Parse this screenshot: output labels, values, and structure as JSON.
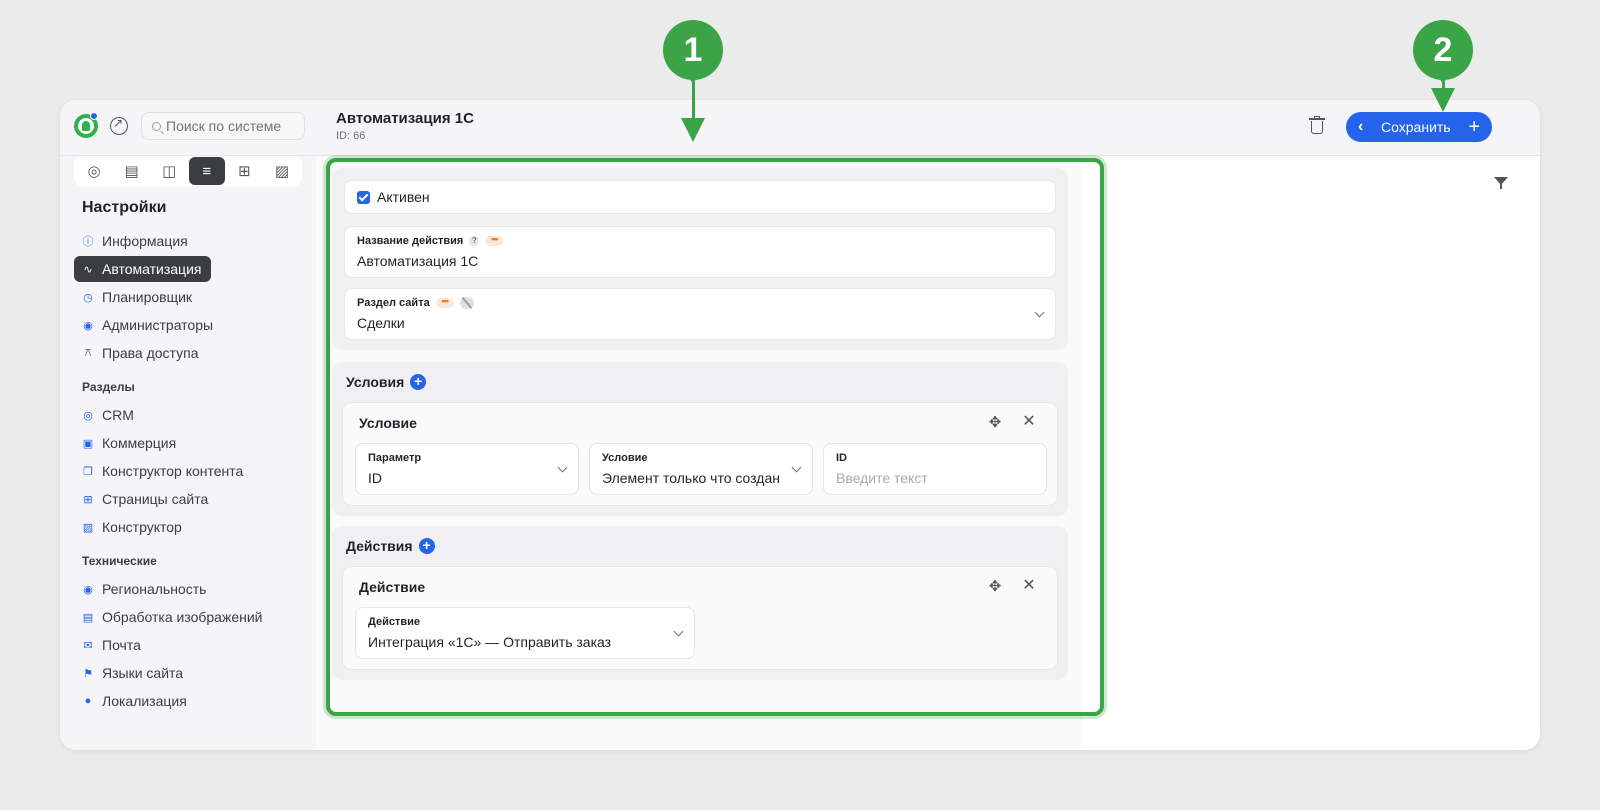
{
  "header": {
    "search_placeholder": "Поиск по системе",
    "title": "Автоматизация 1С",
    "id_label": "ID: 66",
    "save_label": "Сохранить"
  },
  "sidebar": {
    "heading": "Настройки",
    "strip_icons": [
      "crm-icon",
      "content-icon",
      "book-icon",
      "settings-sliders-icon",
      "add-square-icon",
      "constructor-icon"
    ],
    "settings_items": [
      {
        "label": "Информация",
        "icon": "info-icon"
      },
      {
        "label": "Автоматизация",
        "icon": "automation-icon",
        "active": true
      },
      {
        "label": "Планировщик",
        "icon": "scheduler-icon"
      },
      {
        "label": "Администраторы",
        "icon": "admin-icon"
      },
      {
        "label": "Права доступа",
        "icon": "lock-icon"
      }
    ],
    "sections_label": "Разделы",
    "sections_items": [
      {
        "label": "CRM",
        "icon": "crm-icon"
      },
      {
        "label": "Коммерция",
        "icon": "bag-icon"
      },
      {
        "label": "Конструктор контента",
        "icon": "copy-icon"
      },
      {
        "label": "Страницы сайта",
        "icon": "grid-icon"
      },
      {
        "label": "Конструктор",
        "icon": "constructor-icon"
      }
    ],
    "tech_label": "Технические",
    "tech_items": [
      {
        "label": "Региональность",
        "icon": "pin-icon"
      },
      {
        "label": "Обработка изображений",
        "icon": "image-icon"
      },
      {
        "label": "Почта",
        "icon": "mail-icon"
      },
      {
        "label": "Языки сайта",
        "icon": "flag-icon"
      },
      {
        "label": "Локализация",
        "icon": "globe-icon"
      }
    ]
  },
  "form": {
    "active_label": "Активен",
    "active_checked": true,
    "action_name_label": "Название действия",
    "action_name_value": "Автоматизация 1С",
    "site_section_label": "Раздел сайта",
    "site_section_value": "Сделки"
  },
  "conditions": {
    "title": "Условия",
    "card_title": "Условие",
    "param_label": "Параметр",
    "param_value": "ID",
    "condition_label": "Условие",
    "condition_value": "Элемент только что создан",
    "id_label": "ID",
    "id_placeholder": "Введите текст"
  },
  "actions": {
    "title": "Действия",
    "card_title": "Действие",
    "action_label": "Действие",
    "action_value": "Интеграция «1С» — Отправить заказ"
  },
  "annotations": {
    "marker_1": "1",
    "marker_2": "2"
  },
  "colors": {
    "accent": "#2563eb",
    "annotation": "#3ba446",
    "active_nav": "#3a3d42"
  }
}
